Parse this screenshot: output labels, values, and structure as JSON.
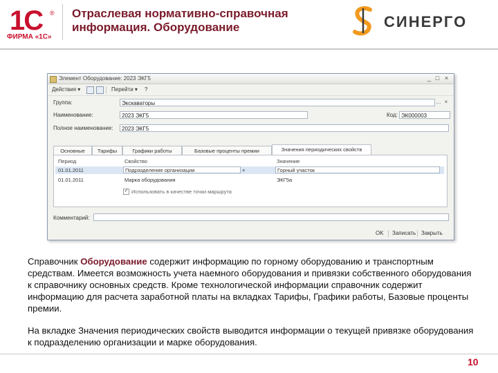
{
  "header": {
    "logo_1c": "1С",
    "logo_1c_reg": "®",
    "logo_firma": "ФИРМА «1С»",
    "title_line1": "Отраслевая нормативно-справочная",
    "title_line2": "информация. Оборудование",
    "sinergo_text": "СИНЕРГО"
  },
  "colors": {
    "accent_red": "#c8102e",
    "title_maroon": "#7a1a2a",
    "sinergo_orange": "#f29a1f"
  },
  "window": {
    "title": "Элемент Оборудование: 2023 ЭКГ5",
    "toolbar": {
      "actions_label": "Действия ▾",
      "goto_label": "Перейти ▾",
      "help_label": "?"
    },
    "group_label": "Группа:",
    "group_value": "Экскаваторы",
    "name_label": "Наименование:",
    "name_value": "2023 ЭКГ5",
    "code_label": "Код:",
    "code_value": "ЭК000003",
    "fullname_label": "Полное наименование:",
    "fullname_value": "2023 ЭКГ5",
    "tabs": [
      {
        "label": "Основные"
      },
      {
        "label": "Тарифы"
      },
      {
        "label": "Графики работы"
      },
      {
        "label": "Базовые проценты премии"
      },
      {
        "label": "Значения периодических свойств"
      }
    ],
    "grid": {
      "col_period": "Период",
      "col_property": "Свойство",
      "col_value": "Значение",
      "rows": [
        {
          "period": "01.01.2011",
          "property": "Подразделение организации",
          "value": "Горный участок"
        },
        {
          "period": "01.01.2011",
          "property": "Марка оборудования",
          "value": "ЭКГ5а"
        }
      ],
      "checkbox_label": "Использовать в качестве точки маршрута"
    },
    "comment_label": "Комментарий:",
    "comment_value": "",
    "buttons": {
      "ok": "OK",
      "save": "Записать",
      "close": "Закрыть"
    }
  },
  "body": {
    "p1_prefix": "Справочник ",
    "p1_bold": "Оборудование",
    "p1_rest": " содержит информацию по горному оборудованию и транспортным средствам. Имеется возможность учета наемного оборудования и привязки собственного оборудования к справочнику основных средств. Кроме технологической информации справочник содержит информацию для расчета заработной платы на вкладках Тарифы, Графики работы, Базовые проценты премии.",
    "p2": "На вкладке Значения периодических свойств выводится информации о текущей привязке оборудования к подразделению организации и марке оборудования."
  },
  "page_number": "10"
}
